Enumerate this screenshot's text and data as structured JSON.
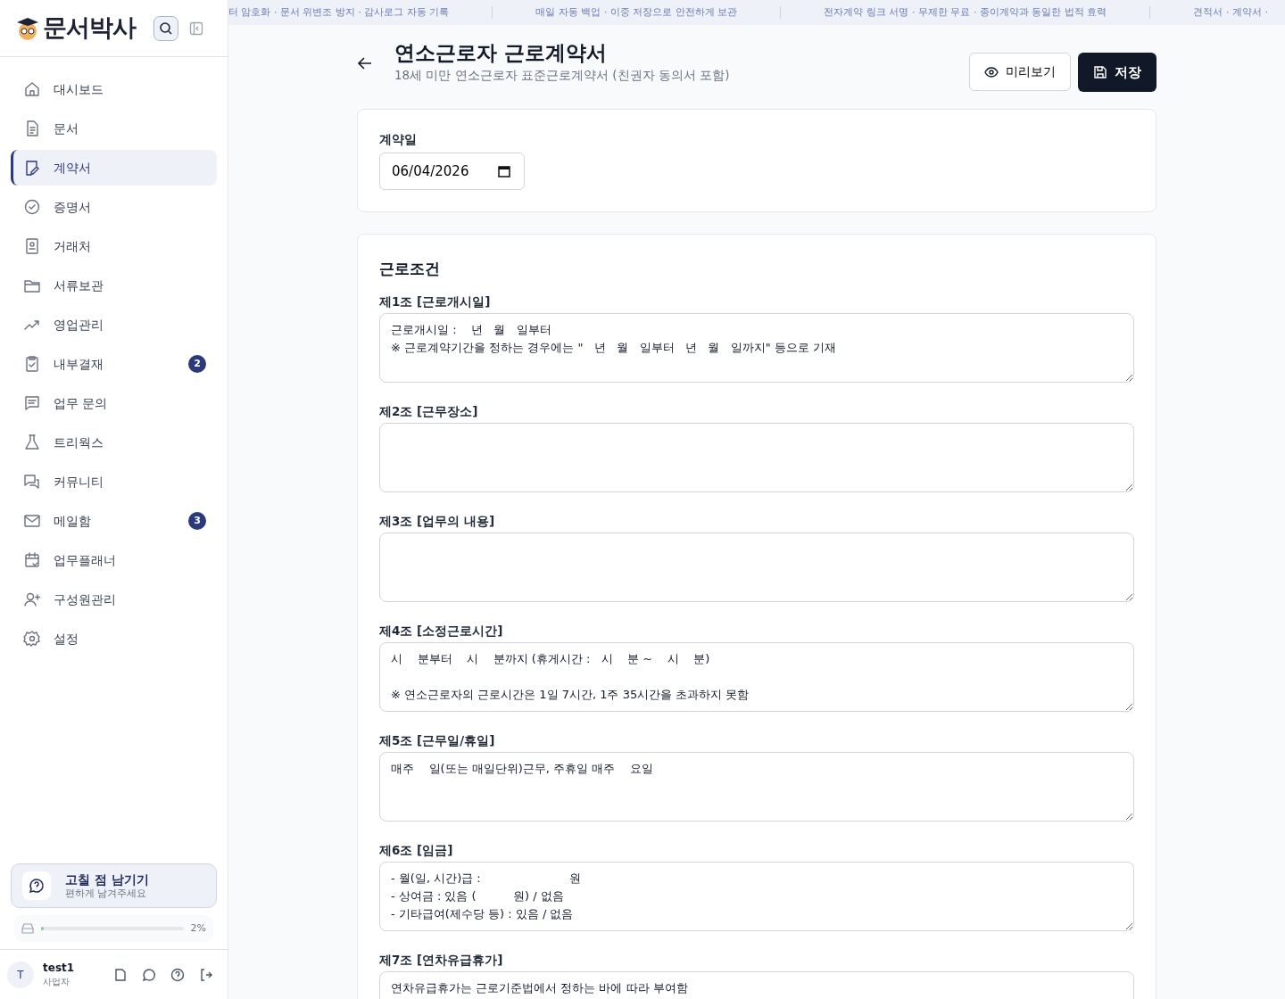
{
  "brand": {
    "name": "문서박사"
  },
  "ticker": [
    "터 암호화 · 문서 위변조 방지 · 감사로그 자동 기록",
    "매일 자동 백업 · 이중 저장으로 안전하게 보관",
    "전자계약 링크 서명 · 무제한 무료 · 종이계약과 동일한 법적 효력",
    "견적서 · 계약서 ·"
  ],
  "sidebar": {
    "items": [
      {
        "label": "대시보드",
        "selected": false
      },
      {
        "label": "문서",
        "selected": false
      },
      {
        "label": "계약서",
        "selected": true
      },
      {
        "label": "증명서",
        "selected": false
      },
      {
        "label": "거래처",
        "selected": false
      },
      {
        "label": "서류보관",
        "selected": false
      },
      {
        "label": "영업관리",
        "selected": false
      },
      {
        "label": "내부결재",
        "selected": false,
        "badge": "2"
      },
      {
        "label": "업무 문의",
        "selected": false
      },
      {
        "label": "트리웍스",
        "selected": false
      },
      {
        "label": "커뮤니티",
        "selected": false
      },
      {
        "label": "메일함",
        "selected": false,
        "badge": "3"
      },
      {
        "label": "업무플래너",
        "selected": false
      },
      {
        "label": "구성원관리",
        "selected": false
      },
      {
        "label": "설정",
        "selected": false
      }
    ],
    "feedback": {
      "title": "고칠 점 남기기",
      "subtitle": "편하게 남겨주세요"
    },
    "storage": {
      "level": 0.02,
      "reading": "2%"
    },
    "user": {
      "initial": "T",
      "name": "test1",
      "role": "사업자"
    }
  },
  "header": {
    "title": "연소근로자 근로계약서",
    "subtitle": "18세 미만 연소근로자 표준근로계약서 (친권자 동의서 포함)",
    "preview_button": "미리보기",
    "save_button": "저장"
  },
  "date_card": {
    "label": "계약일",
    "value": "06/04/2026"
  },
  "terms": {
    "title": "근로조건",
    "articles": [
      {
        "label": "제1조 [근로개시일]",
        "value": "근로개시일 :    년   월   일부터\n※ 근로계약기간을 정하는 경우에는 \"   년   월   일부터   년   월   일까지\" 등으로 기재"
      },
      {
        "label": "제2조 [근무장소]"
      },
      {
        "label": "제3조 [업무의 내용]"
      },
      {
        "label": "제4조 [소정근로시간]",
        "value": "시    분부터    시    분까지 (휴게시간 :   시    분 ~    시    분)\n\n※ 연소근로자의 근로시간은 1일 7시간, 1주 35시간을 초과하지 못함"
      },
      {
        "label": "제5조 [근무일/휴일]",
        "value": "매주    일(또는 매일단위)근무, 주휴일 매주    요일"
      },
      {
        "label": "제6조 [임금]",
        "value": "- 월(일, 시간)급 :                        원\n- 상여금 : 있음 (          원) / 없음\n- 기타급여(제수당 등) : 있음 / 없음"
      },
      {
        "label": "제7조 [연차유급휴가]",
        "value": "연차유급휴가는 근로기준법에서 정하는 바에 따라 부여함"
      }
    ]
  }
}
